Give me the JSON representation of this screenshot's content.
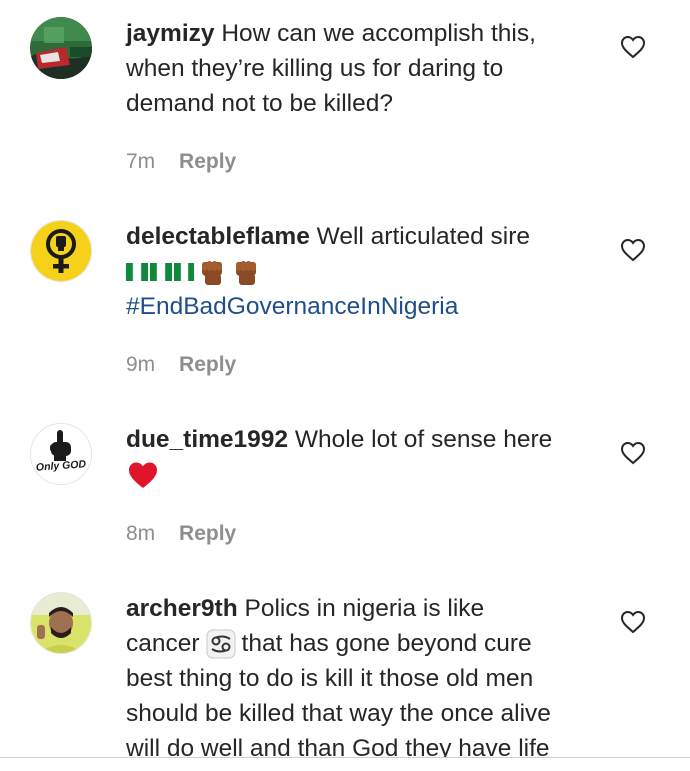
{
  "colors": {
    "username": "#262626",
    "meta": "#8e8e8e",
    "hashtag": "#1f4f8a",
    "heart": "#e0152b"
  },
  "comments": [
    {
      "username": "jaymizy",
      "text": "How can we accomplish this,",
      "text2": "when they’re killing us for daring to",
      "text3": "demand not to be killed?",
      "time": "7m",
      "reply": "Reply",
      "avatar_icon": "flag-photo-avatar"
    },
    {
      "username": "delectableflame",
      "text": "Well articulated sire",
      "emojis": [
        "nigeria-flag-icon",
        "raised-fist-icon",
        "raised-fist-icon"
      ],
      "hashtag": "#EndBadGovernanceInNigeria",
      "time": "9m",
      "reply": "Reply",
      "avatar_icon": "feminist-fist-avatar"
    },
    {
      "username": "due_time1992",
      "text": "Whole lot of sense here",
      "emojis": [
        "red-heart-icon"
      ],
      "time": "8m",
      "reply": "Reply",
      "avatar_icon": "only-god-avatar",
      "avatar_text": "Only GOD"
    },
    {
      "username": "archer9th",
      "text": "Polics in nigeria is like",
      "text2a": "cancer",
      "text2b": "that has gone beyond cure",
      "text3": "best thing to do is kill it those old men",
      "text4": "should be killed that way the once alive",
      "text5": "will do well and than God they have life",
      "emojis": [
        "cancer-zodiac-icon"
      ],
      "avatar_icon": "man-photo-avatar"
    }
  ]
}
